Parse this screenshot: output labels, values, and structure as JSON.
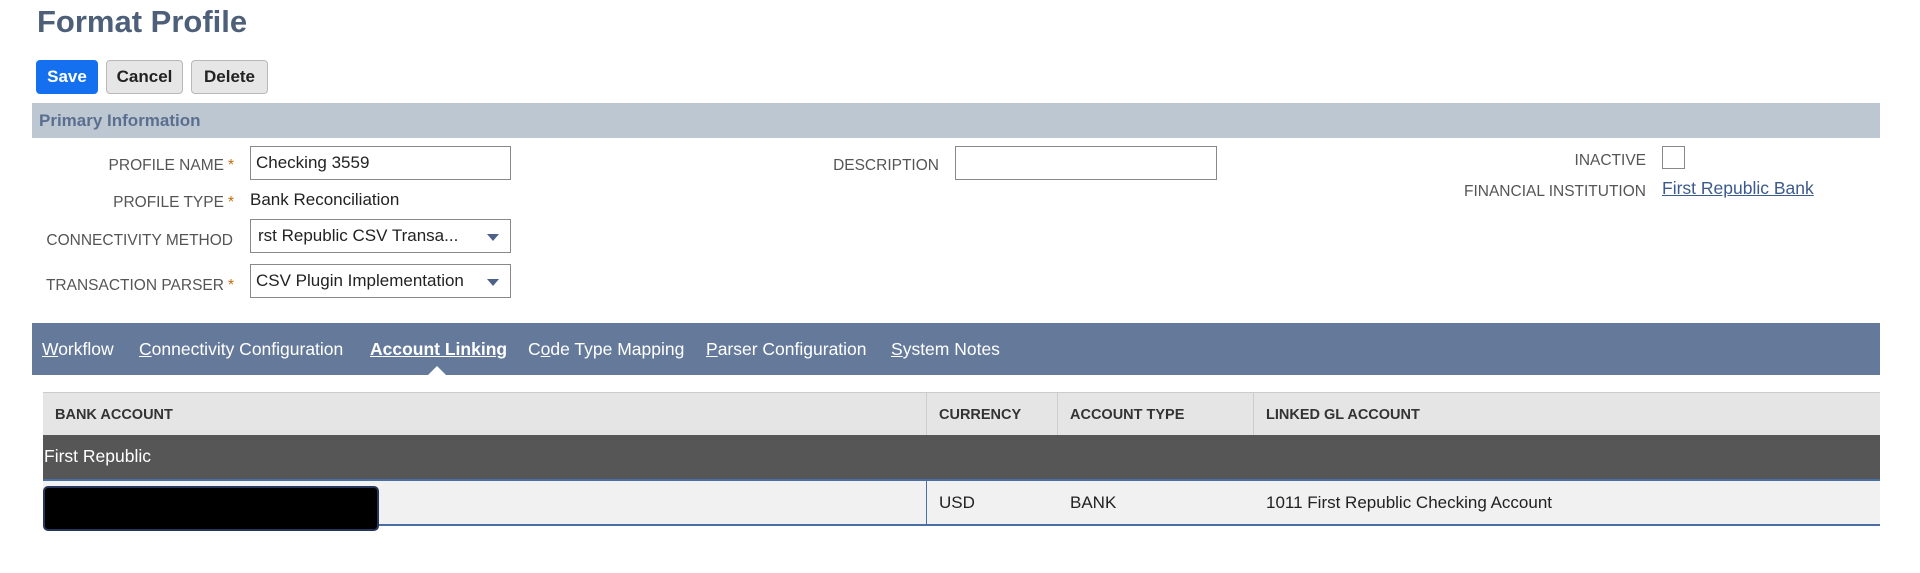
{
  "page": {
    "title": "Format Profile"
  },
  "toolbar": {
    "save": "Save",
    "cancel": "Cancel",
    "delete": "Delete"
  },
  "primary_info": {
    "section_title": "Primary Information",
    "profile_name": {
      "label": "PROFILE NAME",
      "required": "*",
      "value": "Checking 3559"
    },
    "profile_type": {
      "label": "PROFILE TYPE",
      "required": "*",
      "value": "Bank Reconciliation"
    },
    "connectivity_method": {
      "label": "CONNECTIVITY METHOD",
      "value": "rst Republic CSV Transa..."
    },
    "transaction_parser": {
      "label": "TRANSACTION PARSER",
      "required": "*",
      "value": "CSV Plugin Implementation"
    },
    "description": {
      "label": "DESCRIPTION",
      "value": ""
    },
    "inactive": {
      "label": "INACTIVE",
      "checked": false
    },
    "financial_institution": {
      "label": "FINANCIAL INSTITUTION",
      "value": "First Republic Bank"
    }
  },
  "tabs": [
    {
      "key": "W",
      "rest": "orkflow"
    },
    {
      "key": "C",
      "rest": "onnectivity Configuration"
    },
    {
      "key": "A",
      "rest": "ccount Linking",
      "active": true
    },
    {
      "pre": "C",
      "key": "o",
      "rest": "de Type Mapping"
    },
    {
      "key": "P",
      "rest": "arser Configuration"
    },
    {
      "key": "S",
      "rest": "ystem Notes"
    }
  ],
  "table": {
    "columns": [
      "BANK ACCOUNT",
      "CURRENCY",
      "ACCOUNT TYPE",
      "LINKED GL ACCOUNT"
    ],
    "group": "First Republic",
    "rows": [
      {
        "bank_account": "",
        "currency": "USD",
        "account_type": "BANK",
        "linked_gl_account": "1011 First Republic Checking Account"
      }
    ]
  },
  "colors": {
    "accent": "#1570ef",
    "tab_bar": "#657a9b",
    "section_bar": "#bdc7d2",
    "required": "#c36b0b"
  }
}
